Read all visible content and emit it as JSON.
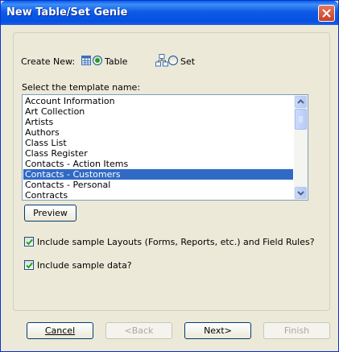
{
  "window": {
    "title": "New Table/Set Genie"
  },
  "create_new": {
    "label": "Create New:",
    "table_label": "Table",
    "set_label": "Set",
    "selected": "Table"
  },
  "template": {
    "label": "Select the template name:",
    "items": [
      "Account Information",
      "Art Collection",
      "Artists",
      "Authors",
      "Class List",
      "Class Register",
      "Contacts - Action Items",
      "Contacts - Customers",
      "Contacts - Personal",
      "Contracts"
    ],
    "selected_index": 7
  },
  "preview_label": "Preview",
  "options": {
    "include_layouts_label": "Include sample Layouts (Forms, Reports, etc.) and Field Rules?",
    "include_layouts_checked": true,
    "include_data_label": "Include sample data?",
    "include_data_checked": true
  },
  "footer": {
    "cancel_label": "Cancel",
    "back_label": "<Back",
    "next_label": "Next>",
    "finish_label": "Finish"
  },
  "colors": {
    "selection": "#316ac5",
    "titlebar": "#0a5fe4",
    "close": "#c6402a"
  }
}
